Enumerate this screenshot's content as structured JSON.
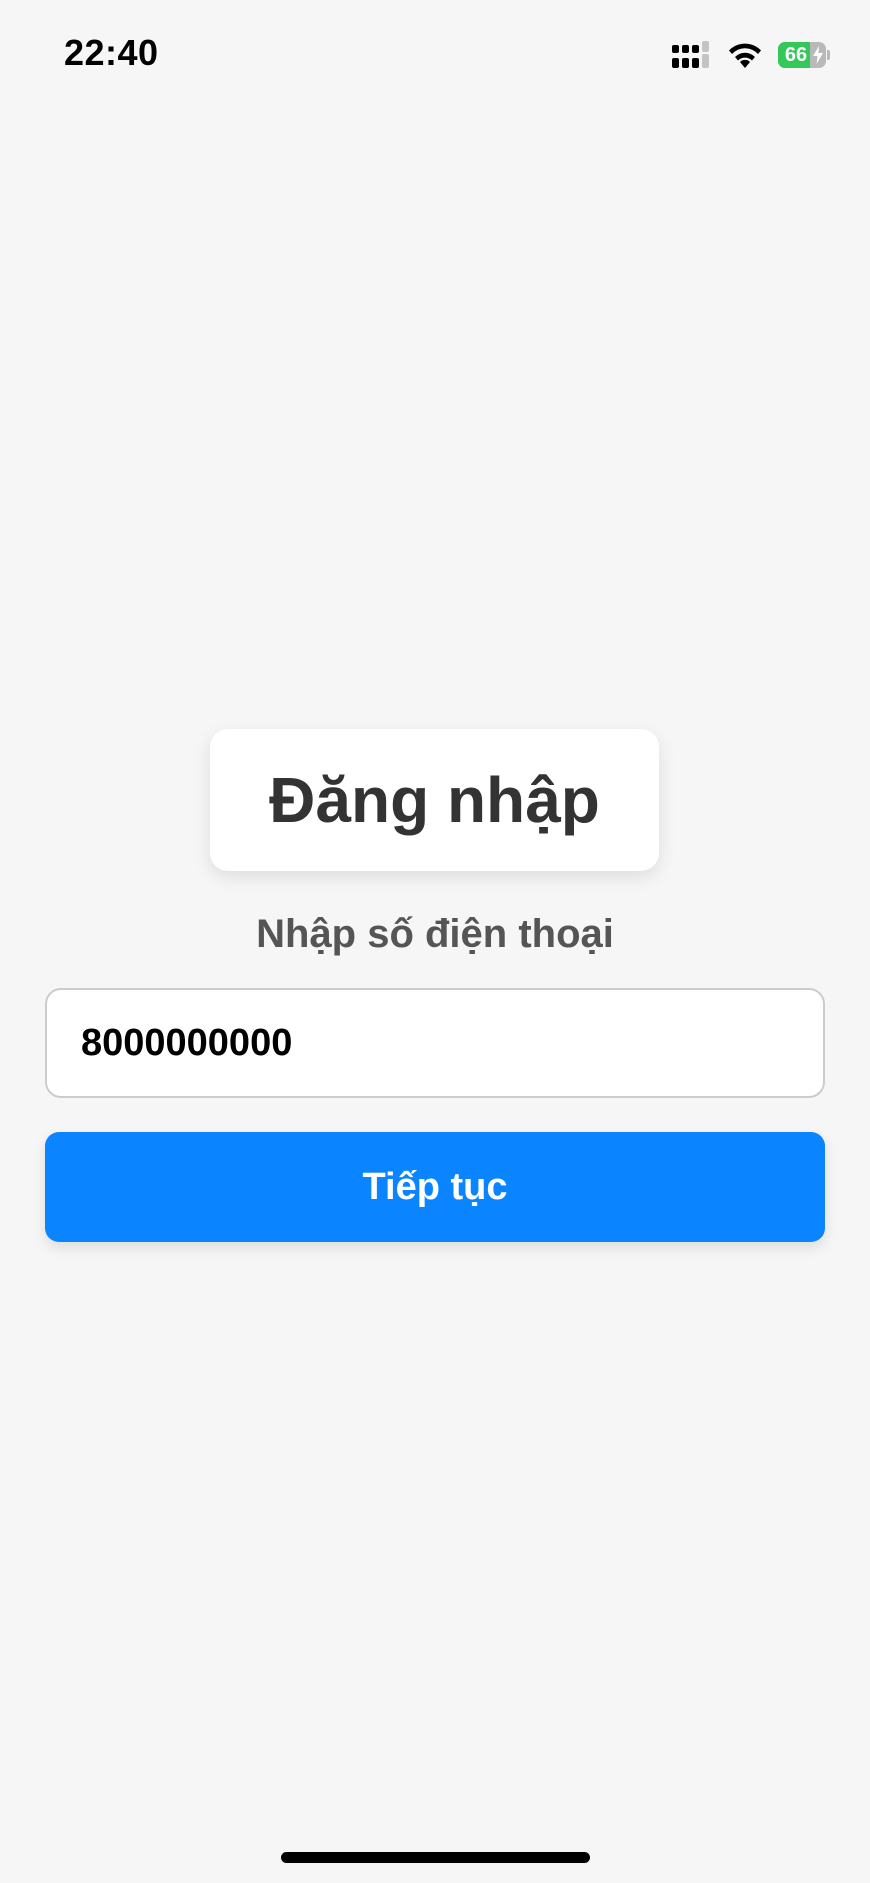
{
  "status_bar": {
    "time": "22:40",
    "battery_percent": "66",
    "battery_level": 0.66,
    "battery_charging": true,
    "battery_color": "#34c759",
    "icons": [
      "signal-icon",
      "wifi-icon",
      "battery-icon",
      "charging-bolt-icon"
    ]
  },
  "login": {
    "title": "Đăng nhập",
    "phone_label": "Nhập số điện thoại",
    "phone_value": "8000000000",
    "continue_label": "Tiếp tục"
  },
  "colors": {
    "background": "#f6f6f6",
    "accent": "#0a84ff",
    "title_text": "#333333",
    "label_text": "#555555"
  }
}
